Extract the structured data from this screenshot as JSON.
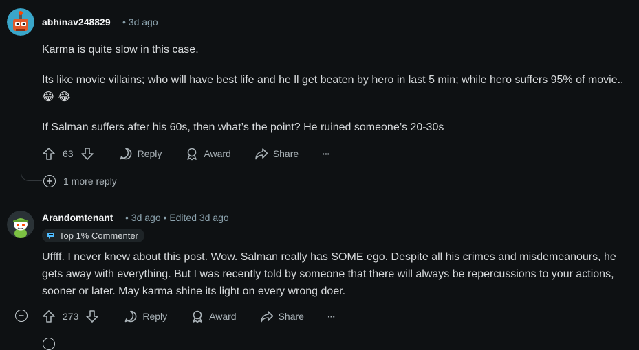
{
  "comments": [
    {
      "username": "abhinav248829",
      "time": "3d ago",
      "paragraphs": [
        "Karma is quite slow in this case.",
        "Its like movie villains; who will have best life and he ll get beaten by hero in last 5 min; while hero suffers 95% of movie..",
        "If Salman suffers after his 60s, then what’s the point? He ruined someone’s 20-30s"
      ],
      "emoji": "😂 😂",
      "votes": "63",
      "reply_label": "Reply",
      "award_label": "Award",
      "share_label": "Share",
      "more_replies": "1 more reply"
    },
    {
      "username": "Arandomtenant",
      "time": "3d ago",
      "edited": "Edited 3d ago",
      "badge": "Top 1% Commenter",
      "paragraphs": [
        "Uffff. I never knew about this post. Wow. Salman really has SOME ego. Despite all his crimes and misdemeanours, he gets away with everything. But I was recently told by someone that there will always be repercussions to your actions, sooner or later. May karma shine its light on every wrong doer."
      ],
      "votes": "273",
      "reply_label": "Reply",
      "award_label": "Award",
      "share_label": "Share"
    }
  ],
  "separator": "•",
  "overflow_glyph": "···",
  "icons": [
    "robot-avatar-icon",
    "snoo-avatar-icon",
    "upvote-icon",
    "downvote-icon",
    "comment-icon",
    "award-icon",
    "share-icon",
    "overflow-icon",
    "expand-plus-icon",
    "collapse-minus-icon",
    "top-commenter-icon"
  ]
}
